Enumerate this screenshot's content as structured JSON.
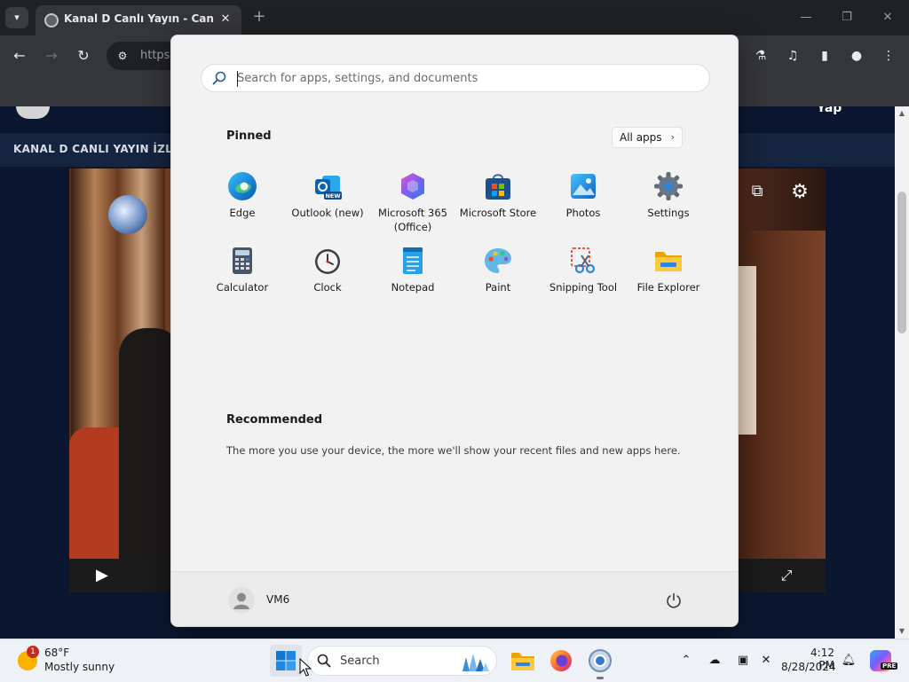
{
  "browser": {
    "tab_title": "Kanal D Canlı Yayın - Canlı TV İ",
    "url_text": "https:",
    "new_tab_symbol": "+",
    "close_tab_symbol": "✕"
  },
  "page": {
    "header_title": "KANAL D CANLI YAYIN İZLE",
    "top_right_text": " Yap"
  },
  "start_menu": {
    "search_placeholder": "Search for apps, settings, and documents",
    "pinned_heading": "Pinned",
    "all_apps_label": "All apps",
    "pinned_apps": [
      {
        "label": "Edge",
        "icon": "edge-icon"
      },
      {
        "label": "Outlook (new)",
        "icon": "outlook-icon",
        "badge": "NEW"
      },
      {
        "label": "Microsoft 365 (Office)",
        "icon": "microsoft-365-icon"
      },
      {
        "label": "Microsoft Store",
        "icon": "microsoft-store-icon"
      },
      {
        "label": "Photos",
        "icon": "photos-icon"
      },
      {
        "label": "Settings",
        "icon": "settings-gear-icon"
      },
      {
        "label": "Calculator",
        "icon": "calculator-icon"
      },
      {
        "label": "Clock",
        "icon": "clock-icon"
      },
      {
        "label": "Notepad",
        "icon": "notepad-icon"
      },
      {
        "label": "Paint",
        "icon": "paint-icon"
      },
      {
        "label": "Snipping Tool",
        "icon": "snipping-tool-icon"
      },
      {
        "label": "File Explorer",
        "icon": "file-explorer-icon"
      }
    ],
    "recommended_heading": "Recommended",
    "recommended_text": "The more you use your device, the more we'll show your recent files and new apps here.",
    "user_name": "VM6"
  },
  "taskbar": {
    "weather_badge": "1",
    "weather_temp": "68°F",
    "weather_desc": "Mostly sunny",
    "search_label": "Search",
    "time": "4:12 PM",
    "date": "8/28/2024",
    "copilot_badge": "PRE"
  },
  "colors": {
    "accent": "#0067c0",
    "start_bg": "#f2f2f2",
    "taskbar_bg": "#eef1f5",
    "page_bg": "#0b1730"
  }
}
